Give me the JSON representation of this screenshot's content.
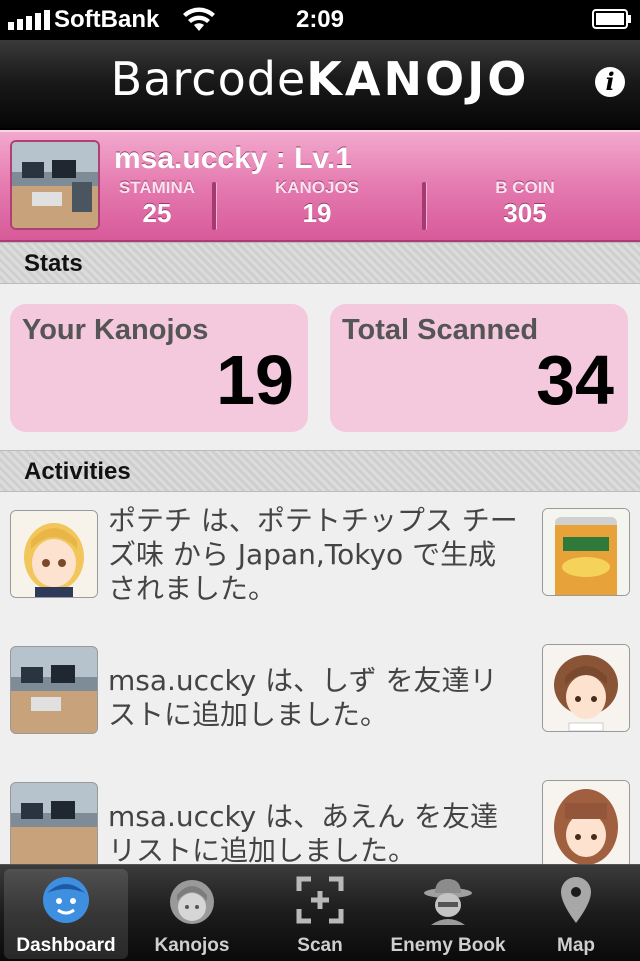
{
  "status_bar": {
    "carrier": "SoftBank",
    "time": "2:09"
  },
  "nav": {
    "title_part1": "Barcode",
    "title_part2": "KANOJO",
    "info_label": "i"
  },
  "profile": {
    "name": "msa.uccky : Lv.1",
    "stats": [
      {
        "label": "STAMINA",
        "value": "25"
      },
      {
        "label": "KANOJOS",
        "value": "19"
      },
      {
        "label": "B COIN",
        "value": "305"
      }
    ]
  },
  "stats_section": {
    "header": "Stats",
    "your_kanojos_label": "Your Kanojos",
    "your_kanojos_value": "19",
    "total_scanned_label": "Total Scanned",
    "total_scanned_value": "34"
  },
  "activities_section": {
    "header": "Activities",
    "items": [
      {
        "text": "ポテチ は、ポテトチップス チーズ味 から Japan,Tokyo で生成されました。"
      },
      {
        "text": "msa.uccky は、しず を友達リストに追加しました。"
      },
      {
        "text": "msa.uccky は、あえん を友達リストに追加しました。"
      }
    ]
  },
  "tab_bar": {
    "tabs": [
      {
        "label": "Dashboard"
      },
      {
        "label": "Kanojos"
      },
      {
        "label": "Scan"
      },
      {
        "label": "Enemy Book"
      },
      {
        "label": "Map"
      }
    ]
  },
  "colors": {
    "pink_band": "#e57ab0",
    "card_pink": "#f4c9dd",
    "tab_active": "#3f8fe0"
  }
}
